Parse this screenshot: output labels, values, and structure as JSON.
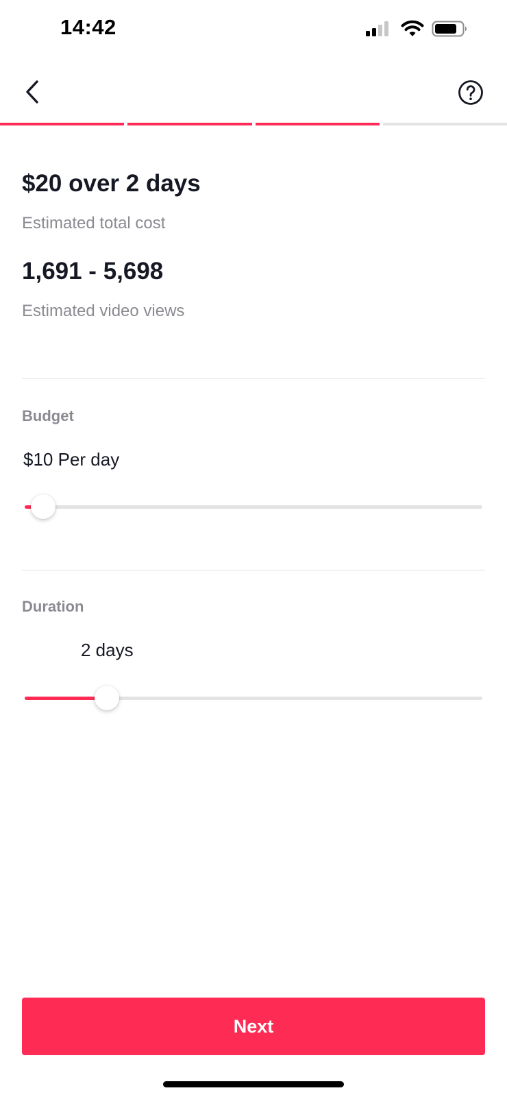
{
  "status_bar": {
    "time": "14:42"
  },
  "icons": {
    "back": "chevron-left-icon",
    "help": "question-circle-icon",
    "signal": "cellular-signal-icon",
    "wifi": "wifi-icon",
    "battery": "battery-icon"
  },
  "progress": {
    "total_steps": 4,
    "completed_steps": 3
  },
  "summary": {
    "total_cost": "$20 over 2 days",
    "total_cost_label": "Estimated total cost",
    "views": "1,691 - 5,698",
    "views_label": "Estimated video views"
  },
  "budget": {
    "label": "Budget",
    "value_text": "$10 Per day",
    "slider_fraction": 0.04
  },
  "duration": {
    "label": "Duration",
    "value_text": "2 days",
    "slider_fraction": 0.18
  },
  "footer": {
    "next_label": "Next"
  },
  "colors": {
    "accent": "#fe2c55",
    "primary_text": "#161823",
    "secondary_text": "#8a8b91",
    "track": "#e3e3e4"
  }
}
